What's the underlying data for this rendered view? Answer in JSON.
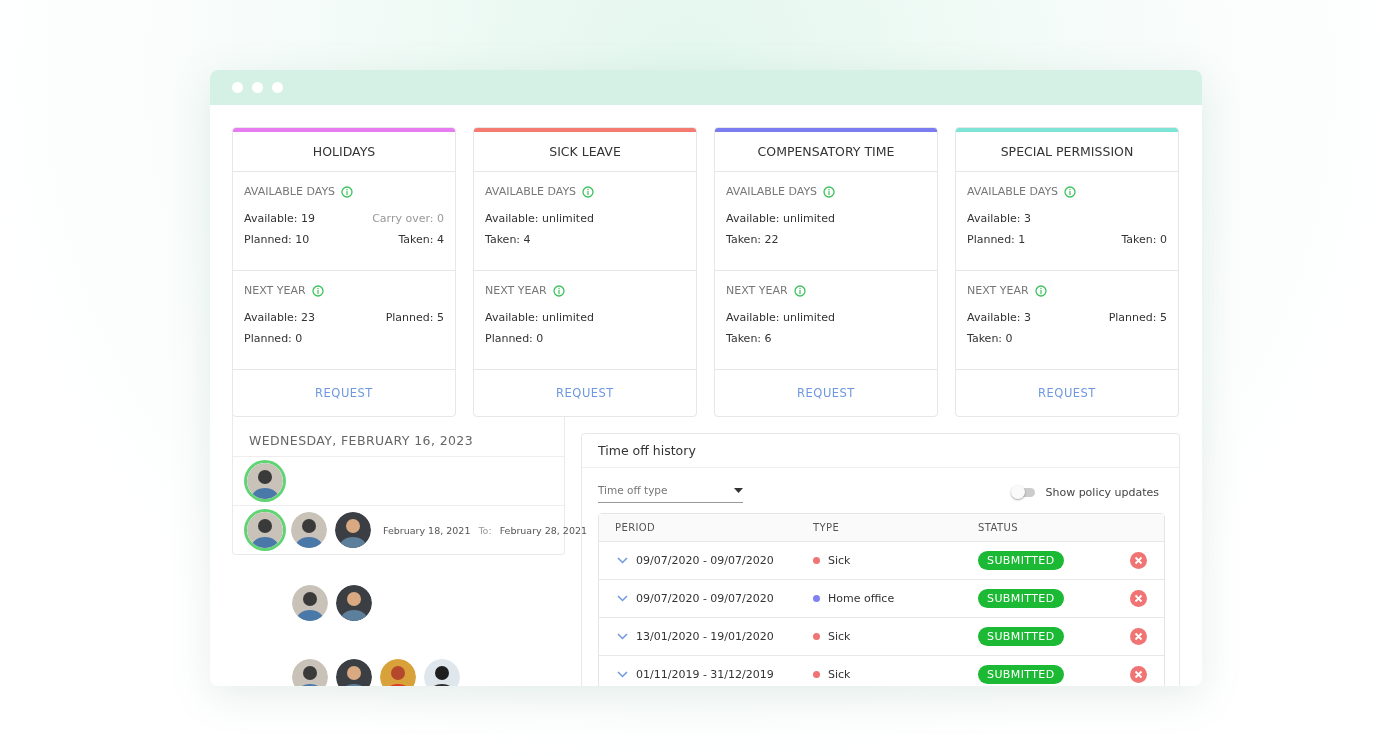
{
  "cards": [
    {
      "title": "HOLIDAYS",
      "color": "#e77bf0",
      "sections": [
        {
          "label": "AVAILABLE DAYS",
          "rows": [
            [
              {
                "text": "Available: 19",
                "muted": false
              },
              {
                "text": "Carry over: 0",
                "muted": true
              }
            ],
            [
              {
                "text": "Planned: 10",
                "muted": false
              },
              {
                "text": "Taken: 4",
                "muted": false
              }
            ]
          ]
        },
        {
          "label": "NEXT YEAR",
          "rows": [
            [
              {
                "text": "Available: 23",
                "muted": false
              },
              {
                "text": "Planned: 5",
                "muted": false
              }
            ],
            [
              {
                "text": "Planned: 0",
                "muted": false
              }
            ]
          ]
        }
      ],
      "action": "REQUEST"
    },
    {
      "title": "SICK LEAVE",
      "color": "#f47a72",
      "sections": [
        {
          "label": "AVAILABLE DAYS",
          "rows": [
            [
              {
                "text": "Available: unlimited",
                "muted": false
              }
            ],
            [
              {
                "text": "Taken: 4",
                "muted": false
              }
            ]
          ]
        },
        {
          "label": "NEXT YEAR",
          "rows": [
            [
              {
                "text": "Available: unlimited",
                "muted": false
              }
            ],
            [
              {
                "text": "Planned: 0",
                "muted": false
              }
            ]
          ]
        }
      ],
      "action": "REQUEST"
    },
    {
      "title": "COMPENSATORY TIME",
      "color": "#7b7cf0",
      "sections": [
        {
          "label": "AVAILABLE DAYS",
          "rows": [
            [
              {
                "text": "Available: unlimited",
                "muted": false
              }
            ],
            [
              {
                "text": "Taken: 22",
                "muted": false
              }
            ]
          ]
        },
        {
          "label": "NEXT YEAR",
          "rows": [
            [
              {
                "text": "Available: unlimited",
                "muted": false
              }
            ],
            [
              {
                "text": "Taken: 6",
                "muted": false
              }
            ]
          ]
        }
      ],
      "action": "REQUEST"
    },
    {
      "title": "SPECIAL PERMISSION",
      "color": "#7ee5d6",
      "sections": [
        {
          "label": "AVAILABLE DAYS",
          "rows": [
            [
              {
                "text": "Available: 3",
                "muted": false
              }
            ],
            [
              {
                "text": "Planned: 1",
                "muted": false
              },
              {
                "text": "Taken: 0",
                "muted": false
              }
            ]
          ]
        },
        {
          "label": "NEXT YEAR",
          "rows": [
            [
              {
                "text": "Available: 3",
                "muted": false
              },
              {
                "text": "Planned: 5",
                "muted": false
              }
            ],
            [
              {
                "text": "Taken: 0",
                "muted": false
              }
            ]
          ]
        }
      ],
      "action": "REQUEST"
    }
  ],
  "absence_panel": {
    "date": "WEDNESDAY, FEBRUARY 16, 2023",
    "from_value": "February 18, 2021",
    "to_label": "To:",
    "to_value": "February 28, 2021",
    "rows": [
      [
        {
          "kind": "avatar",
          "highlighted": true
        }
      ],
      [
        {
          "kind": "avatar",
          "highlighted": true
        },
        {
          "kind": "avatar",
          "highlighted": false
        },
        {
          "kind": "avatar",
          "highlighted": false
        }
      ]
    ]
  },
  "avatar_groups": [
    [
      {
        "kind": "avatar",
        "highlighted": false
      },
      {
        "kind": "avatar",
        "highlighted": false
      }
    ],
    [
      {
        "kind": "avatar",
        "highlighted": false
      },
      {
        "kind": "avatar",
        "highlighted": false
      },
      {
        "kind": "avatar",
        "highlighted": false
      },
      {
        "kind": "avatar",
        "highlighted": false
      }
    ]
  ],
  "history": {
    "title": "Time off history",
    "filter": {
      "placeholder": "Time off type"
    },
    "toggle": {
      "label": "Show policy updates",
      "on": false
    },
    "table": {
      "columns": [
        "PERIOD",
        "TYPE",
        "STATUS"
      ],
      "rows": [
        {
          "period": "09/07/2020 - 09/07/2020",
          "type": "Sick",
          "color": "#f07474",
          "status": "SUBMITTED"
        },
        {
          "period": "09/07/2020 - 09/07/2020",
          "type": "Home office",
          "color": "#8181f2",
          "status": "SUBMITTED"
        },
        {
          "period": "13/01/2020 - 19/01/2020",
          "type": "Sick",
          "color": "#f07474",
          "status": "SUBMITTED"
        },
        {
          "period": "01/11/2019 - 31/12/2019",
          "type": "Sick",
          "color": "#f07474",
          "status": "SUBMITTED"
        }
      ]
    }
  }
}
